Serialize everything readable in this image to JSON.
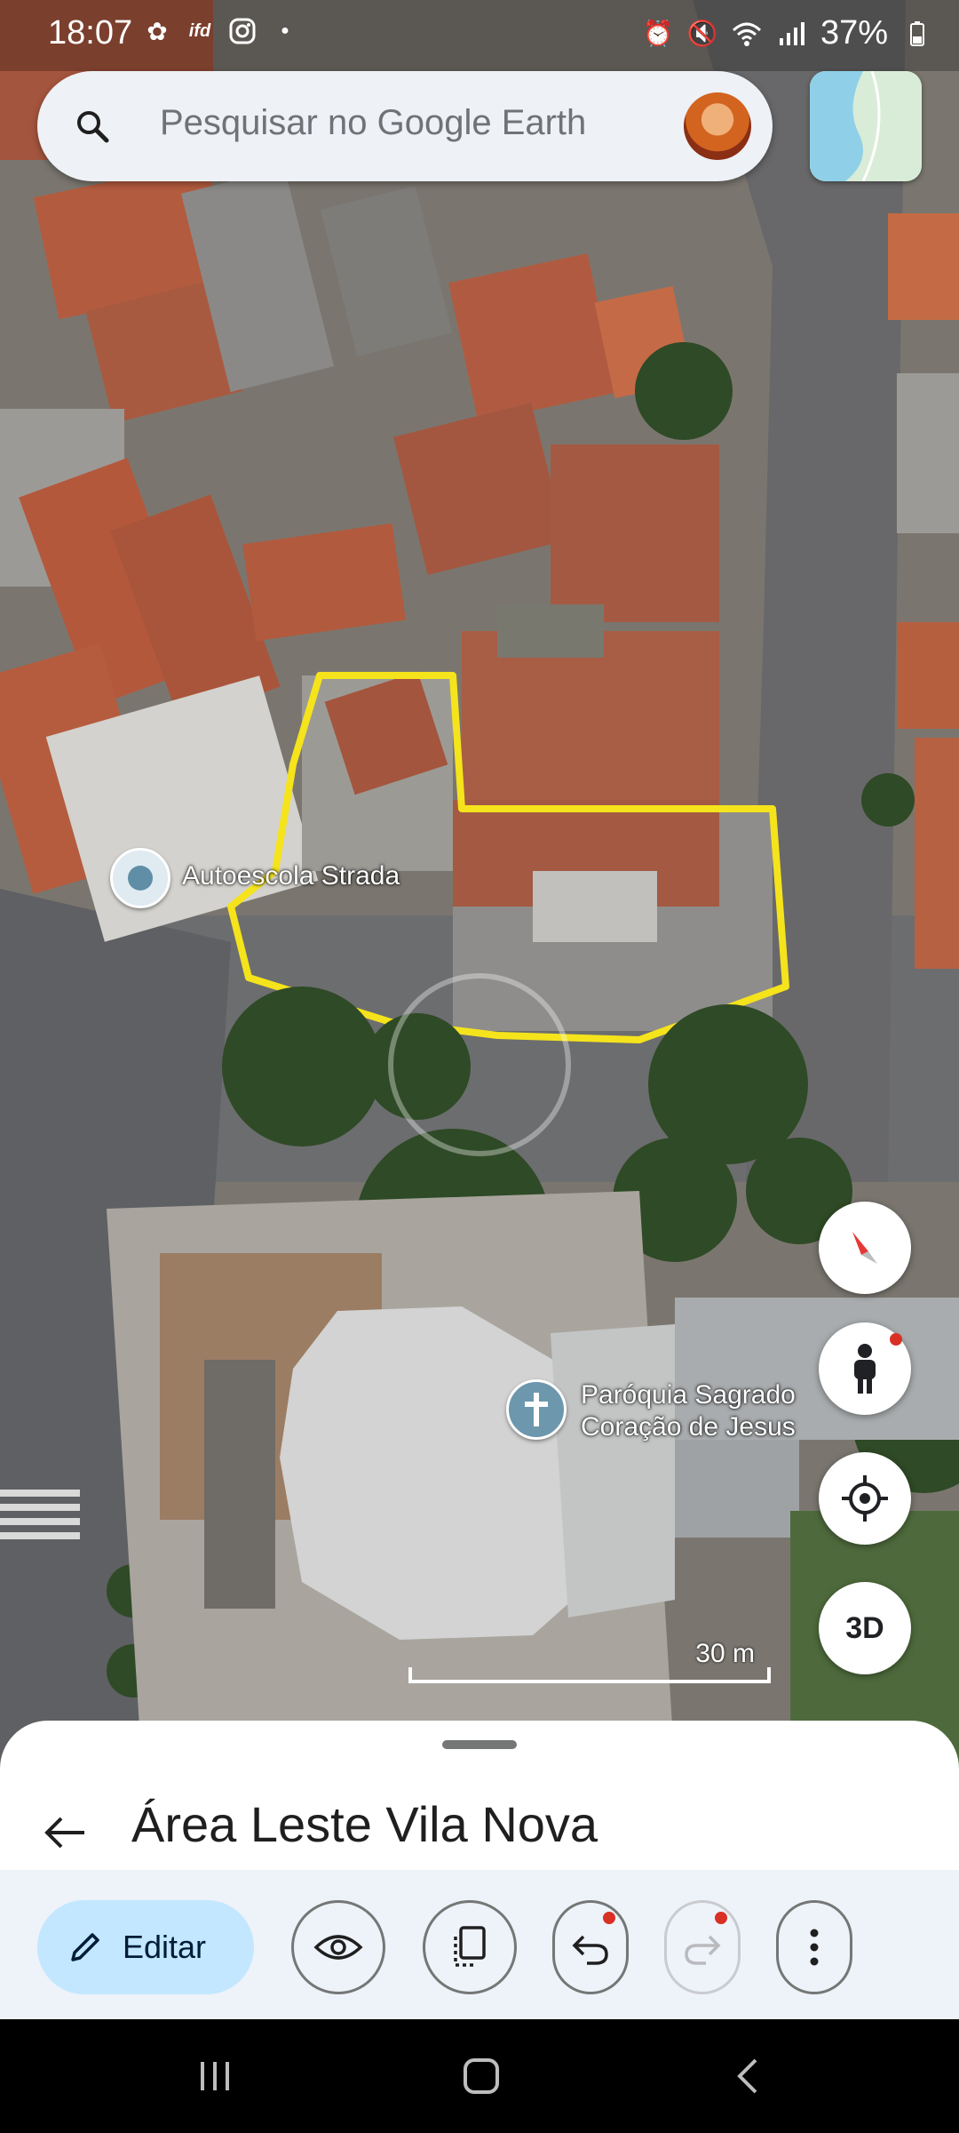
{
  "status_bar": {
    "time": "18:07",
    "left_icons": [
      "bug-icon",
      "ifood-icon",
      "instagram-icon",
      "dot-icon"
    ],
    "right_icons": [
      "alarm-icon",
      "mute-icon",
      "wifi-icon",
      "signal-icon"
    ],
    "battery": "37%"
  },
  "search": {
    "placeholder": "Pesquisar no Google Earth"
  },
  "map": {
    "places": [
      {
        "label": "Autoescola Strada"
      },
      {
        "label": "Paróquia Sagrado\nCoração de Jesus"
      }
    ],
    "scale": "30 m",
    "outline_color": "#f5e31c"
  },
  "controls": {
    "three_d": "3D"
  },
  "sheet": {
    "title": "Área Leste Vila Nova"
  },
  "toolbar": {
    "edit_label": "Editar"
  }
}
